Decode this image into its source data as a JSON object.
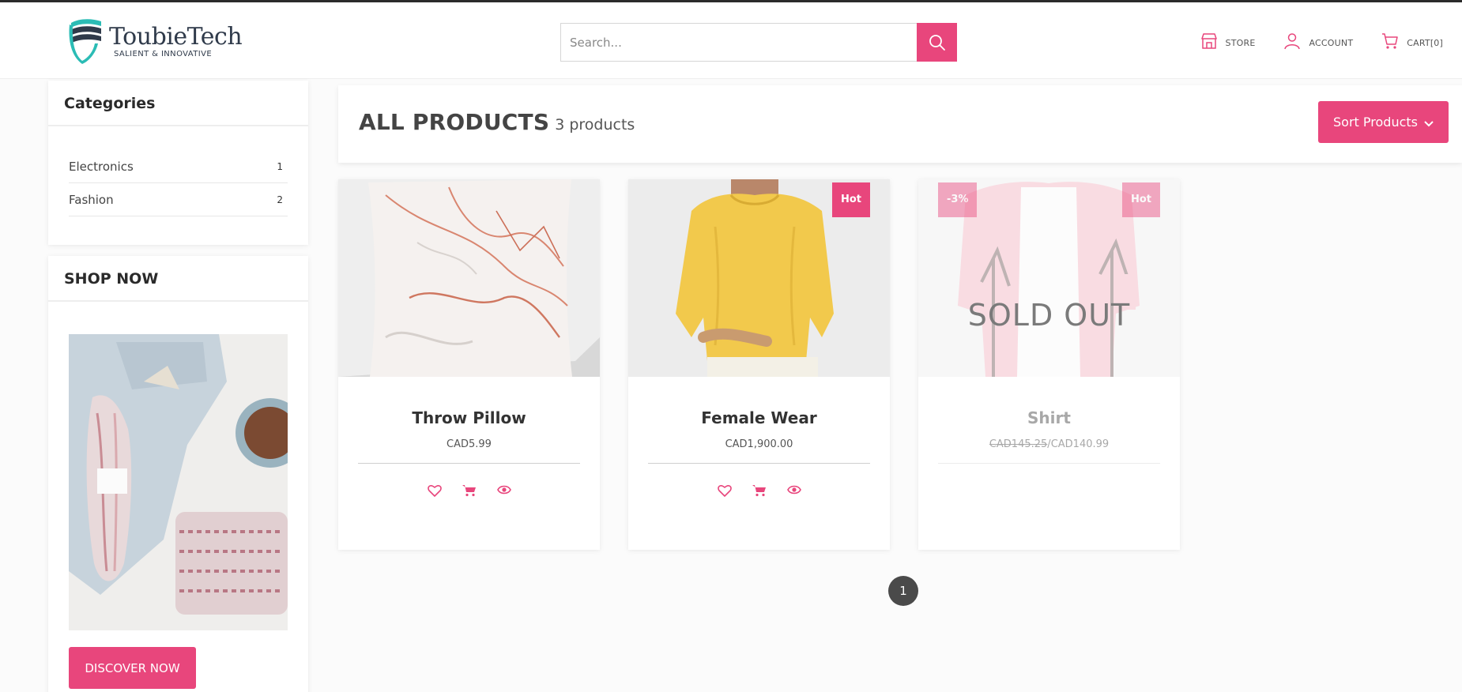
{
  "brand": {
    "name": "ToubieTech",
    "tagline": "SALIENT & INNOVATIVE"
  },
  "search": {
    "placeholder": "Search...",
    "value": ""
  },
  "nav": [
    {
      "label": "STORE",
      "icon": "store-icon"
    },
    {
      "label": "ACCOUNT",
      "icon": "user-icon"
    },
    {
      "label": "CART[0]",
      "icon": "cart-icon"
    }
  ],
  "sidebar": {
    "categories_title": "Categories",
    "categories": [
      {
        "name": "Electronics",
        "count": "1"
      },
      {
        "name": "Fashion",
        "count": "2"
      }
    ],
    "shop_title": "SHOP NOW",
    "shop_button": "DISCOVER NOW"
  },
  "main": {
    "title": "ALL PRODUCTS",
    "count": "3 products",
    "sort_label": "Sort Products"
  },
  "products": [
    {
      "name": "Throw Pillow",
      "price": "CAD5.99",
      "badges": []
    },
    {
      "name": "Female Wear",
      "price": "CAD1,900.00",
      "badges": [
        "Hot"
      ]
    },
    {
      "name": "Shirt",
      "old_price": "CAD145.25",
      "price": "CAD140.99",
      "badges": [
        "-3%",
        "Hot"
      ],
      "status": "SOLD OUT"
    }
  ],
  "pagination": {
    "current": "1"
  },
  "colors": {
    "accent": "#e8467c",
    "dark": "#4a4a4a",
    "brand_teal": "#2bbcb5"
  }
}
